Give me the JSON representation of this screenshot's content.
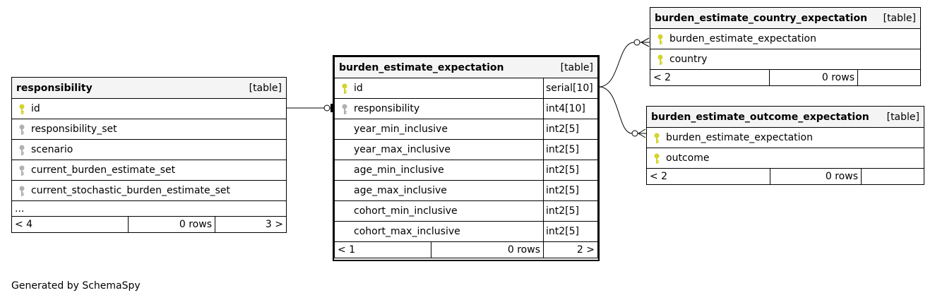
{
  "tables": {
    "responsibility": {
      "name": "responsibility",
      "tag": "[table]",
      "columns": [
        {
          "name": "id",
          "key": "primary"
        },
        {
          "name": "responsibility_set",
          "key": "foreign"
        },
        {
          "name": "scenario",
          "key": "foreign"
        },
        {
          "name": "current_burden_estimate_set",
          "key": "foreign"
        },
        {
          "name": "current_stochastic_burden_estimate_set",
          "key": "foreign"
        }
      ],
      "ellipsis": "...",
      "footer": {
        "parents": "< 4",
        "rows": "0 rows",
        "children": "3 >"
      }
    },
    "burden_estimate_expectation": {
      "name": "burden_estimate_expectation",
      "tag": "[table]",
      "columns": [
        {
          "name": "id",
          "type": "serial[10]",
          "key": "primary"
        },
        {
          "name": "responsibility",
          "type": "int4[10]",
          "key": "foreign"
        },
        {
          "name": "year_min_inclusive",
          "type": "int2[5]",
          "key": "none"
        },
        {
          "name": "year_max_inclusive",
          "type": "int2[5]",
          "key": "none"
        },
        {
          "name": "age_min_inclusive",
          "type": "int2[5]",
          "key": "none"
        },
        {
          "name": "age_max_inclusive",
          "type": "int2[5]",
          "key": "none"
        },
        {
          "name": "cohort_min_inclusive",
          "type": "int2[5]",
          "key": "none"
        },
        {
          "name": "cohort_max_inclusive",
          "type": "int2[5]",
          "key": "none"
        }
      ],
      "footer": {
        "parents": "< 1",
        "rows": "0 rows",
        "children": "2 >"
      }
    },
    "burden_estimate_country_expectation": {
      "name": "burden_estimate_country_expectation",
      "tag": "[table]",
      "columns": [
        {
          "name": "burden_estimate_expectation",
          "key": "primary"
        },
        {
          "name": "country",
          "key": "primary"
        }
      ],
      "footer": {
        "parents": "< 2",
        "rows": "0 rows",
        "children": ""
      }
    },
    "burden_estimate_outcome_expectation": {
      "name": "burden_estimate_outcome_expectation",
      "tag": "[table]",
      "columns": [
        {
          "name": "burden_estimate_expectation",
          "key": "primary"
        },
        {
          "name": "outcome",
          "key": "primary"
        }
      ],
      "footer": {
        "parents": "< 2",
        "rows": "0 rows",
        "children": ""
      }
    }
  },
  "colors": {
    "primary_key": "#d4d42a",
    "foreign_key": "#b0b0b0",
    "header_bg": "#f4f4f4"
  },
  "footer_text": "Generated by SchemaSpy"
}
